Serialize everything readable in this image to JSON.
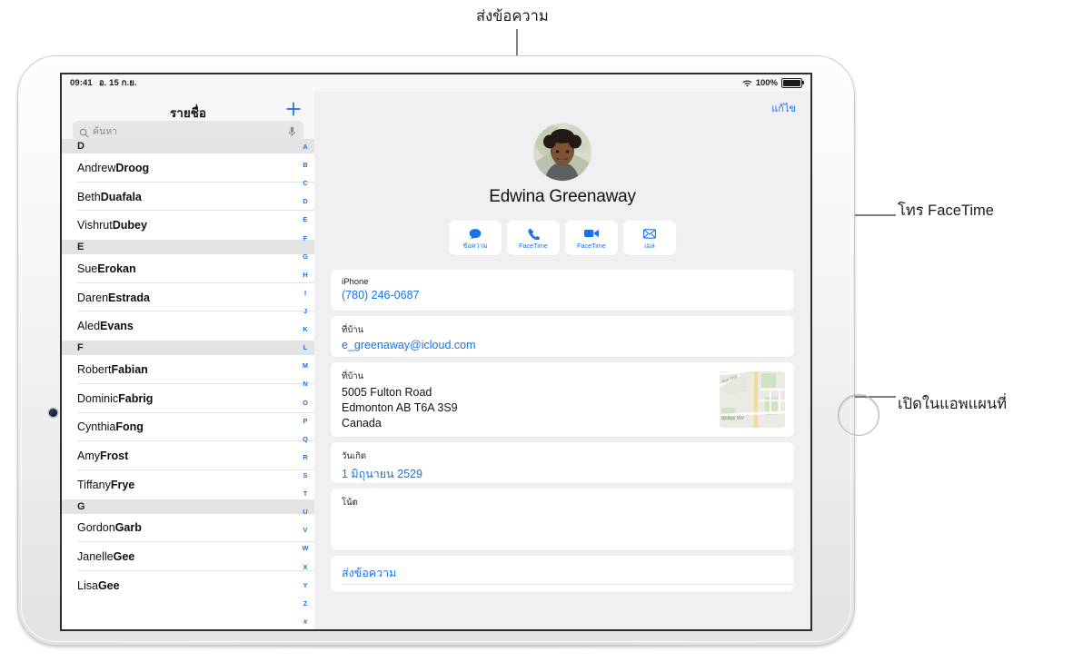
{
  "callouts": [
    {
      "id": "send-message",
      "label": "ส่งข้อความ"
    },
    {
      "id": "facetime-call",
      "label": "โทร FaceTime"
    },
    {
      "id": "open-in-maps",
      "label": "เปิดในแอพแผนที่"
    }
  ],
  "status_bar": {
    "time": "09:41",
    "date": "อ. 15 ก.ย.",
    "wifi_icon": "wifi-icon",
    "battery_percent": "100%",
    "battery_icon": "battery-full-icon"
  },
  "sidebar": {
    "title": "รายชื่อ",
    "add_button_icon": "plus-icon",
    "search": {
      "placeholder": "ค้นหา",
      "search_icon": "search-icon",
      "mic_icon": "microphone-icon"
    },
    "sections": [
      {
        "letter": "D",
        "contacts": [
          {
            "first": "Andrew ",
            "last": "Droog"
          },
          {
            "first": "Beth ",
            "last": "Duafala"
          },
          {
            "first": "Vishrut ",
            "last": "Dubey"
          }
        ]
      },
      {
        "letter": "E",
        "contacts": [
          {
            "first": "Sue ",
            "last": "Erokan"
          },
          {
            "first": "Daren ",
            "last": "Estrada"
          },
          {
            "first": "Aled ",
            "last": "Evans"
          }
        ]
      },
      {
        "letter": "F",
        "contacts": [
          {
            "first": "Robert ",
            "last": "Fabian"
          },
          {
            "first": "Dominic ",
            "last": "Fabrig"
          },
          {
            "first": "Cynthia ",
            "last": "Fong"
          },
          {
            "first": "Amy ",
            "last": "Frost"
          },
          {
            "first": "Tiffany ",
            "last": "Frye"
          }
        ]
      },
      {
        "letter": "G",
        "contacts": [
          {
            "first": "Gordon ",
            "last": "Garb"
          },
          {
            "first": "Janelle ",
            "last": "Gee"
          },
          {
            "first": "Lisa ",
            "last": "Gee"
          }
        ]
      }
    ],
    "index_letters": [
      "A",
      "B",
      "C",
      "D",
      "E",
      "F",
      "G",
      "H",
      "I",
      "J",
      "K",
      "L",
      "M",
      "N",
      "O",
      "P",
      "Q",
      "R",
      "S",
      "T",
      "U",
      "V",
      "W",
      "X",
      "Y",
      "Z",
      "#"
    ]
  },
  "detail": {
    "edit_label": "แก้ไข",
    "avatar_name": "avatar",
    "contact_name": "Edwina Greenaway",
    "actions": [
      {
        "label": "ข้อความ",
        "icon": "message-bubble-icon"
      },
      {
        "label": "FaceTime",
        "icon": "phone-icon"
      },
      {
        "label": "FaceTime",
        "icon": "video-camera-icon"
      },
      {
        "label": "เมล",
        "icon": "envelope-icon"
      }
    ],
    "fields": {
      "phone": {
        "label": "iPhone",
        "value": "(780) 246-0687"
      },
      "email": {
        "label": "ที่บ้าน",
        "value": "e_greenaway@icloud.com"
      },
      "address": {
        "label": "ที่บ้าน",
        "lines": [
          "5005 Fulton Road",
          "Edmonton AB T6A 3S9",
          "Canada"
        ],
        "map_icon": "map-pin-icon",
        "map_labels": [
          "Ave NW",
          "03 Ave NW"
        ]
      },
      "birthday": {
        "label": "วันเกิด",
        "value": "1 มิถุนายน 2529"
      },
      "notes": {
        "label": "โน้ต",
        "value": ""
      },
      "send_message": {
        "label": "ส่งข้อความ"
      }
    }
  },
  "colors": {
    "accent": "#1773ea",
    "detail_bg": "#f0f0f3",
    "section_bg": "#e3e3e4",
    "callout_line": "#808080"
  }
}
